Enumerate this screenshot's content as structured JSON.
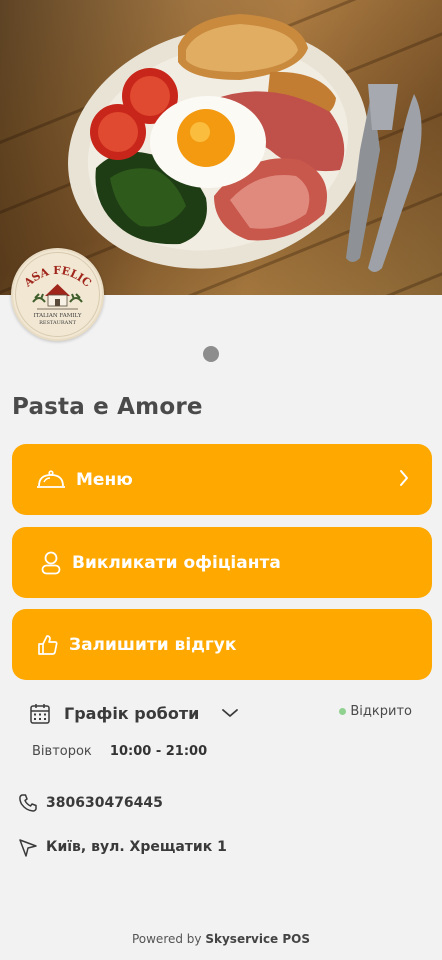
{
  "restaurant": {
    "name": "Pasta e Amore",
    "logo_lines": [
      "CASA FELICE",
      "ITALIAN FAMILY",
      "RESTAURANT"
    ]
  },
  "actions": [
    {
      "label": "Меню",
      "icon": "cloche-icon"
    },
    {
      "label": "Викликати офіціанта",
      "icon": "person-icon"
    },
    {
      "label": "Залишити відгук",
      "icon": "thumbs-up-icon"
    }
  ],
  "schedule": {
    "label": "Графік роботи",
    "status": "Відкрито",
    "day": "Вівторок",
    "hours": "10:00 - 21:00"
  },
  "contacts": {
    "phone": "380630476445",
    "address": "Київ, вул. Хрещатик 1"
  },
  "footer": {
    "prefix": "Powered by",
    "brand": "Skyservice POS"
  },
  "colors": {
    "accent": "#ffa800",
    "background": "#f2f2f3",
    "open_status": "#8fd18f"
  }
}
